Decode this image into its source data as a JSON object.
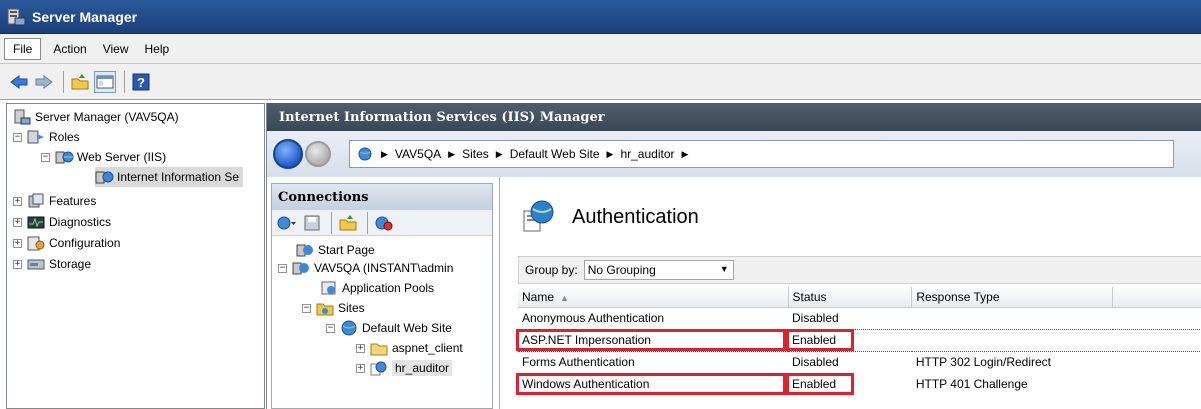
{
  "window": {
    "title": "Server Manager"
  },
  "menu": [
    "File",
    "Action",
    "View",
    "Help"
  ],
  "tree": {
    "root": "Server Manager (VAV5QA)",
    "roles": "Roles",
    "web_server": "Web Server (IIS)",
    "iis_manager": "Internet Information Se",
    "features": "Features",
    "diagnostics": "Diagnostics",
    "configuration": "Configuration",
    "storage": "Storage"
  },
  "iis": {
    "header": "Internet Information Services (IIS) Manager",
    "breadcrumb": [
      "VAV5QA",
      "Sites",
      "Default Web Site",
      "hr_auditor"
    ]
  },
  "connections": {
    "title": "Connections",
    "nodes": {
      "start_page": "Start Page",
      "server": "VAV5QA (INSTANT\\admin",
      "app_pools": "Application Pools",
      "sites": "Sites",
      "default_site": "Default Web Site",
      "aspnet_client": "aspnet_client",
      "hr_auditor": "hr_auditor"
    }
  },
  "feature": {
    "title": "Authentication",
    "group_by_label": "Group by:",
    "group_by_value": "No Grouping",
    "columns": [
      "Name",
      "Status",
      "Response Type"
    ],
    "rows": [
      {
        "name": "Anonymous Authentication",
        "status": "Disabled",
        "response": ""
      },
      {
        "name": "ASP.NET Impersonation",
        "status": "Enabled",
        "response": ""
      },
      {
        "name": "Forms Authentication",
        "status": "Disabled",
        "response": "HTTP 302 Login/Redirect"
      },
      {
        "name": "Windows Authentication",
        "status": "Enabled",
        "response": "HTTP 401 Challenge"
      }
    ]
  },
  "colors": {
    "titlebar": "#1c3f7a",
    "highlight": "#e0202a",
    "iis_header": "#3b4755"
  }
}
